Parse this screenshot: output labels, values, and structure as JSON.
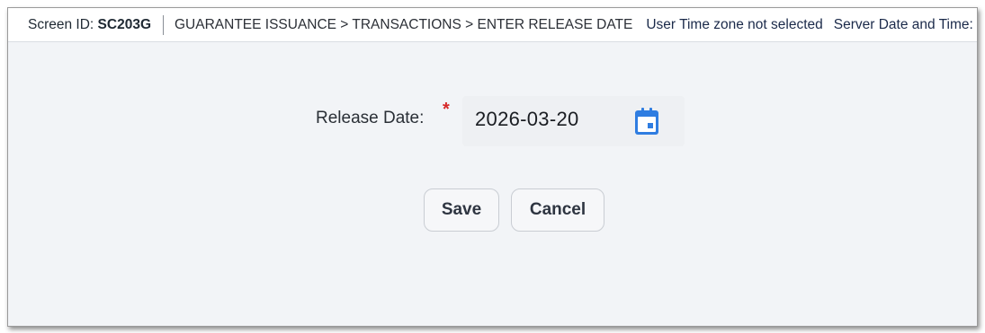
{
  "topbar": {
    "screen_id_label": "Screen ID:",
    "screen_id_value": "SC203G",
    "breadcrumb": "GUARANTEE ISSUANCE > TRANSACTIONS > ENTER RELEASE DATE",
    "timezone_status": "User Time zone not selected",
    "server_datetime_label": "Server Date and Time:"
  },
  "form": {
    "release_date_label": "Release Date:",
    "required_marker": "*",
    "release_date_value": "2026-03-20",
    "calendar_icon": "calendar-icon",
    "required_color": "#d62828",
    "accent_color": "#2f7de1"
  },
  "actions": {
    "save_label": "Save",
    "cancel_label": "Cancel"
  }
}
